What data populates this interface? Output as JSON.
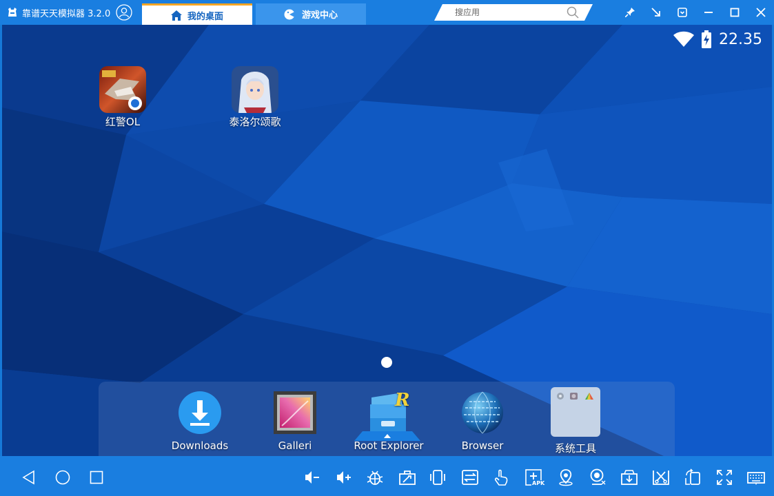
{
  "app": {
    "title": "靠谱天天模拟器 3.2.0"
  },
  "tabs": [
    {
      "label": "我的桌面",
      "icon": "home-icon",
      "active": true
    },
    {
      "label": "游戏中心",
      "icon": "gamepad-icon",
      "active": false
    }
  ],
  "search": {
    "placeholder": "搜应用"
  },
  "window_controls": [
    "pin-icon",
    "minimize-to-tray-icon",
    "restore-icon",
    "minimize-icon",
    "maximize-icon",
    "close-icon"
  ],
  "status": {
    "time": "22.35"
  },
  "desktop_apps": [
    {
      "label": "红警OL"
    },
    {
      "label": "泰洛尔颂歌"
    }
  ],
  "dock": [
    {
      "label": "Downloads"
    },
    {
      "label": "Galleri"
    },
    {
      "label": "Root Explorer"
    },
    {
      "label": "Browser"
    },
    {
      "label": "系统工具"
    }
  ],
  "toolbar": {
    "apk_label": "APK",
    "tools": [
      "volume-down-icon",
      "volume-up-icon",
      "bug-icon",
      "toolbox-icon",
      "shake-icon",
      "sync-icon",
      "touch-icon",
      "install-apk-icon",
      "location-icon",
      "camera-icon",
      "download-icon",
      "screenshot-icon",
      "rotate-icon",
      "fullscreen-icon",
      "keyboard-icon"
    ]
  },
  "colors": {
    "titlebar": "#1a7ee0",
    "tab_accent": "#f5a623",
    "wallpaper": "#0b3f96"
  }
}
